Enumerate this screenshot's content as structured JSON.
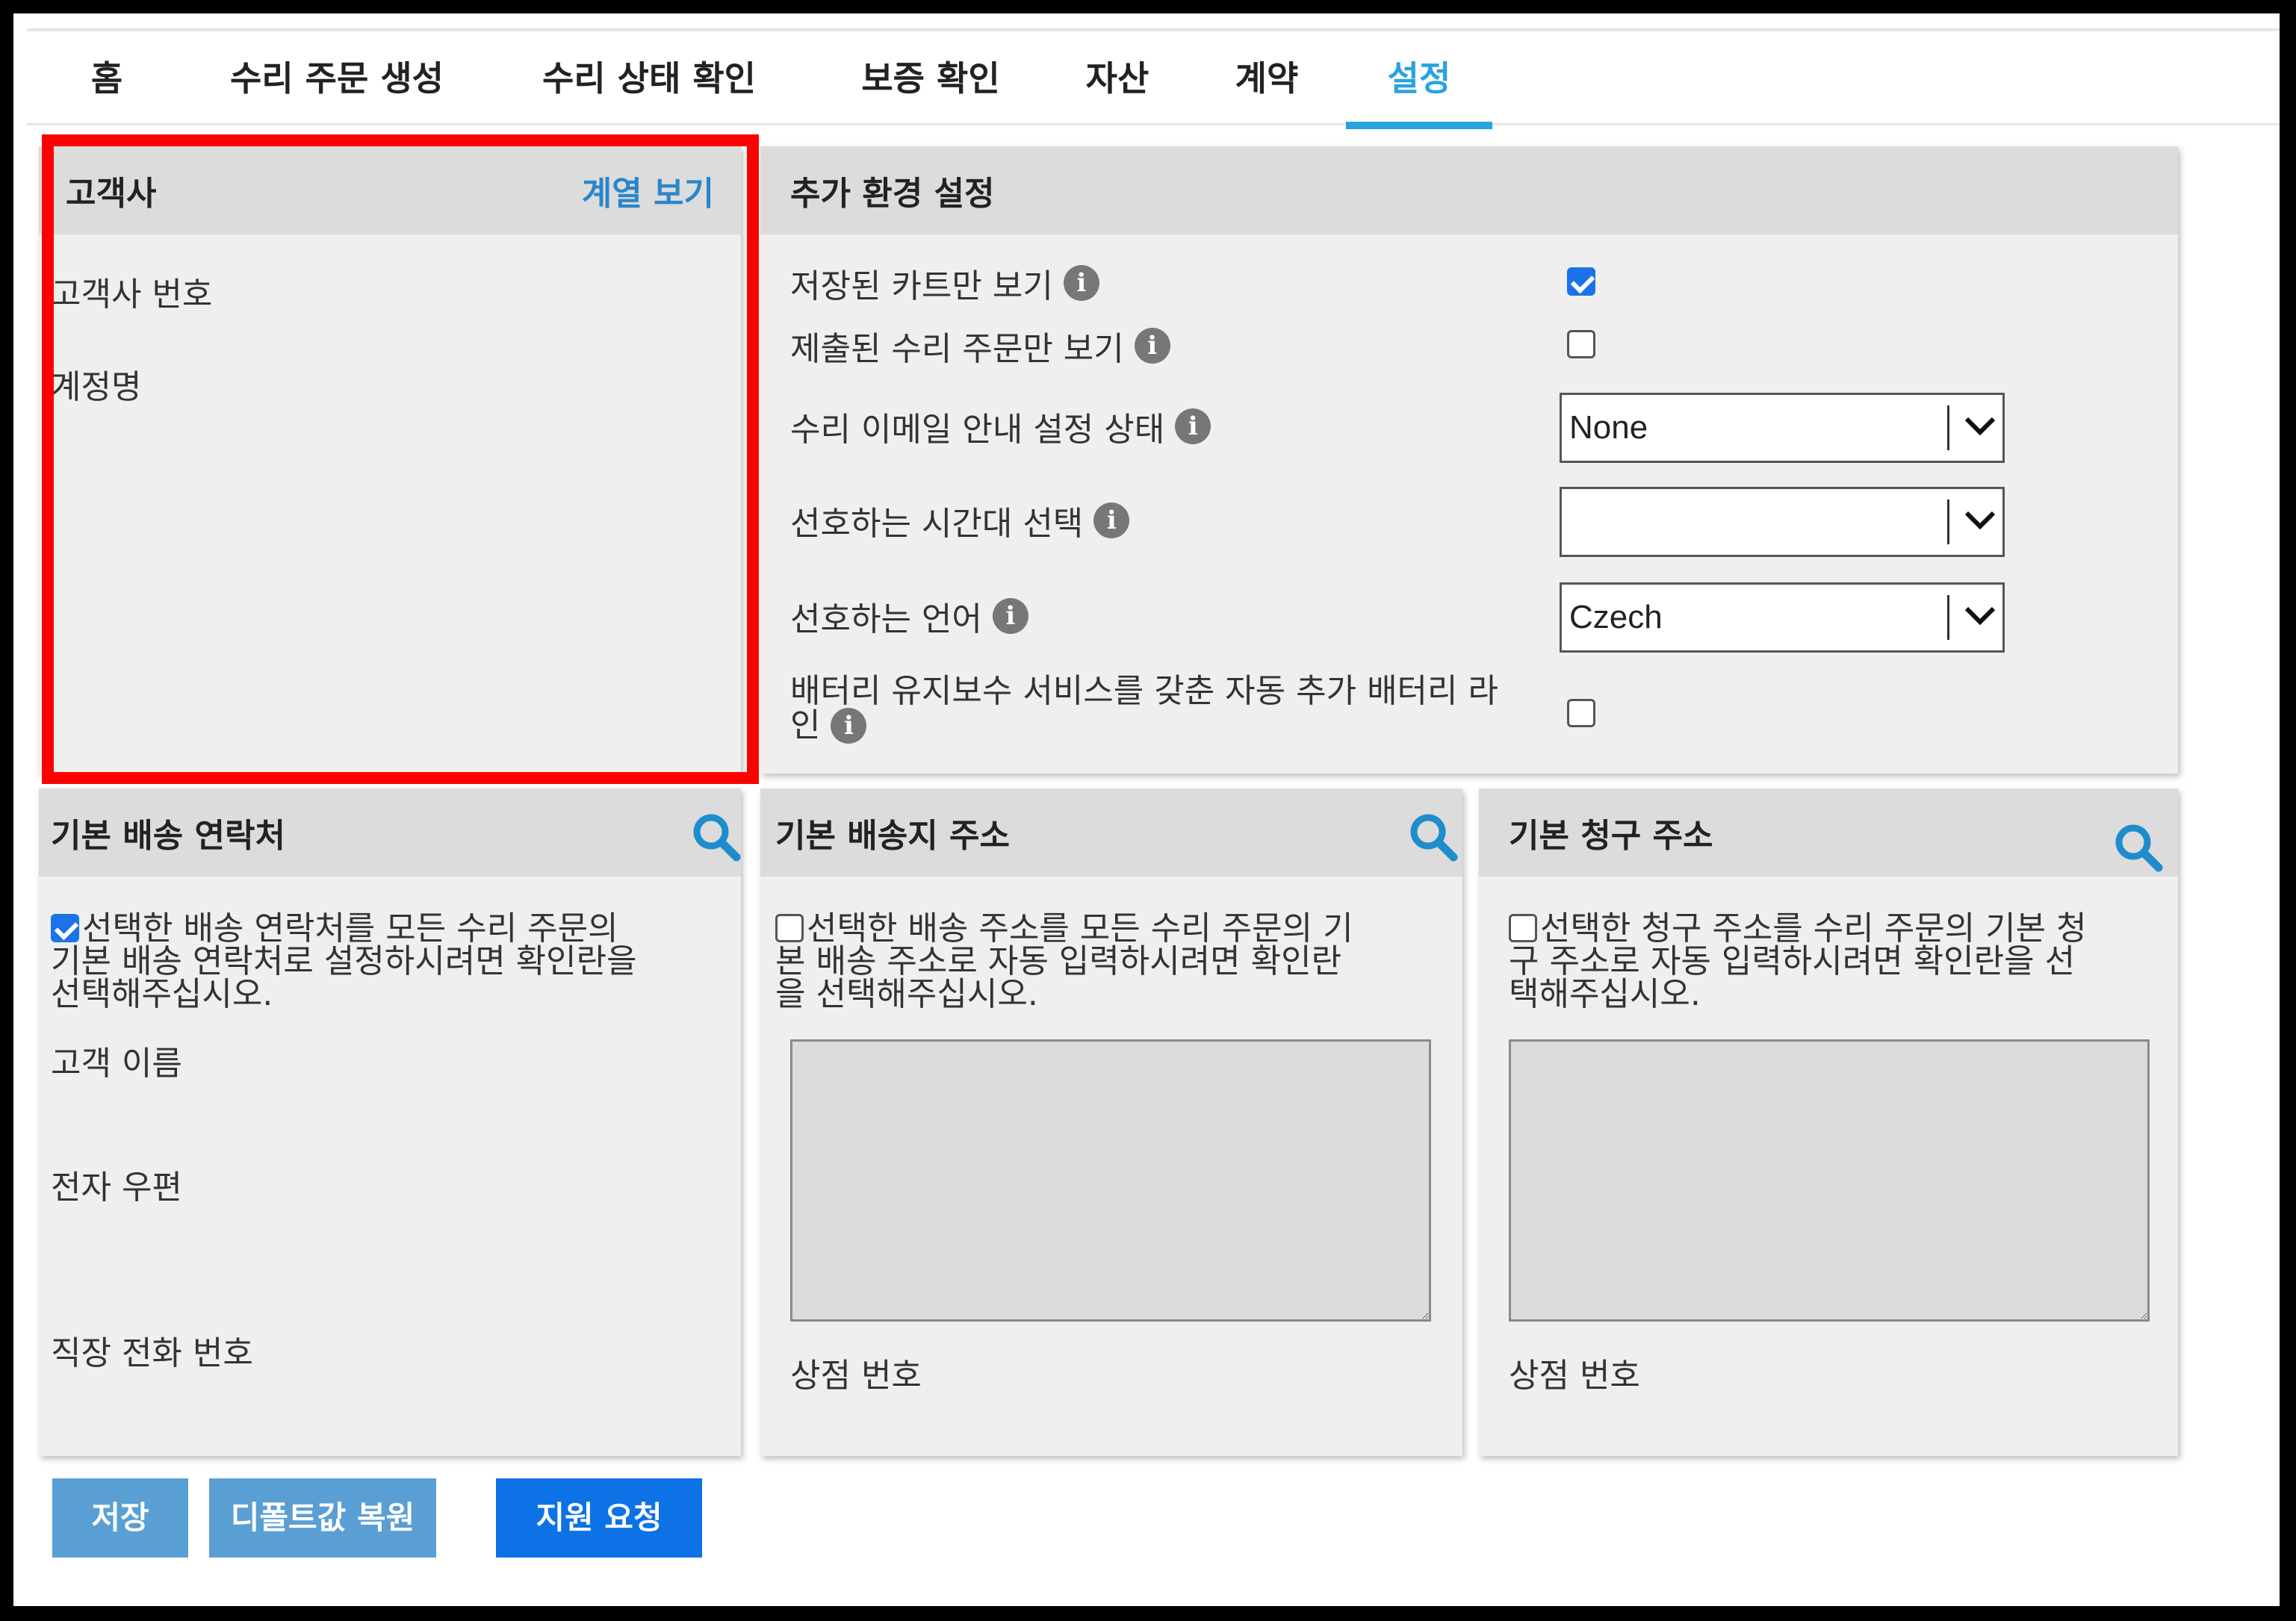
{
  "tabs": [
    {
      "label": "홈"
    },
    {
      "label": "수리 주문 생성"
    },
    {
      "label": "수리 상태 확인"
    },
    {
      "label": "보증 확인"
    },
    {
      "label": "자산"
    },
    {
      "label": "계약"
    },
    {
      "label": "설정",
      "active": true
    }
  ],
  "customer": {
    "title": "고객사",
    "view_link": "계열 보기",
    "fields": [
      "고객사 번호",
      "계정명"
    ]
  },
  "settings": {
    "title": "추가 환경 설정",
    "rows": [
      {
        "label": "저장된 카트만 보기",
        "control": "checkbox",
        "checked": true
      },
      {
        "label": "제출된 수리 주문만 보기",
        "control": "checkbox",
        "checked": false
      },
      {
        "label": "수리 이메일 안내 설정 상태",
        "control": "select",
        "value": "None"
      },
      {
        "label": "선호하는 시간대 선택",
        "control": "select",
        "value": ""
      },
      {
        "label": "선호하는 언어",
        "control": "select",
        "value": "Czech"
      },
      {
        "label_line1": "배터리 유지보수 서비스를 갖춘 자동 추가 배터리 라",
        "label_line2": "인",
        "control": "checkbox",
        "checked": false
      }
    ],
    "info_glyph": "i"
  },
  "shipping_contact": {
    "title": "기본 배송 연락처",
    "checkbox_checked": true,
    "desc_lines": [
      "선택한 배송 연락처를 모든 수리 주문의",
      "기본 배송 연락처로 설정하시려면 확인란을",
      "선택해주십시오."
    ],
    "fields": [
      "고객 이름",
      "전자 우편",
      "직장 전화 번호"
    ]
  },
  "shipping_address": {
    "title": "기본 배송지 주소",
    "checkbox_checked": false,
    "desc_lines": [
      "선택한 배송 주소를 모든 수리 주문의 기",
      "본 배송 주소로 자동 입력하시려면 확인란",
      "을 선택해주십시오."
    ],
    "store_label": "상점 번호"
  },
  "billing_address": {
    "title": "기본 청구 주소",
    "checkbox_checked": false,
    "desc_lines": [
      "선택한 청구 주소를 수리 주문의 기본 청",
      "구 주소로 자동 입력하시려면 확인란을 선",
      "택해주십시오."
    ],
    "store_label": "상점 번호"
  },
  "buttons": {
    "save": "저장",
    "restore_defaults": "디폴트값 복원",
    "support": "지원 요청"
  },
  "colors": {
    "accent": "#29a3df",
    "link": "#2a86c9",
    "highlight": "#ff0000",
    "button_muted": "#5a9fd4",
    "button_primary": "#0d72e6"
  },
  "icons": [
    "search-icon",
    "info-icon",
    "chevron-down-icon"
  ]
}
